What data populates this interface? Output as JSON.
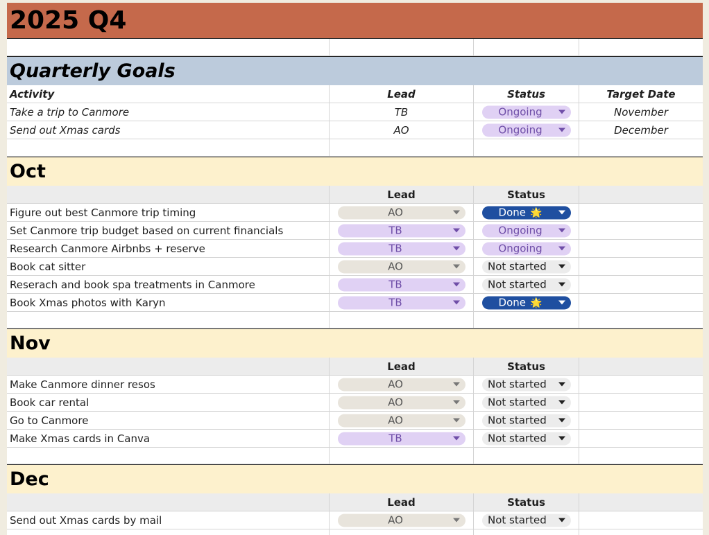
{
  "title": "2025 Q4",
  "goals": {
    "heading": "Quarterly Goals",
    "headers": [
      "Activity",
      "Lead",
      "Status",
      "Target Date"
    ],
    "rows": [
      {
        "activity": "Take a trip to Canmore",
        "lead": "TB",
        "status": "Ongoing",
        "target": "November"
      },
      {
        "activity": "Send out Xmas cards",
        "lead": "AO",
        "status": "Ongoing",
        "target": "December"
      }
    ]
  },
  "months": [
    {
      "name": "Oct",
      "lead_header": "Lead",
      "status_header": "Status",
      "tasks": [
        {
          "task": "Figure out best Canmore trip timing",
          "lead": "AO",
          "status": "Done",
          "star": "🌟"
        },
        {
          "task": "Set Canmore trip budget based on current financials",
          "lead": "TB",
          "status": "Ongoing"
        },
        {
          "task": "Research Canmore Airbnbs + reserve",
          "lead": "TB",
          "status": "Ongoing"
        },
        {
          "task": "Book cat sitter",
          "lead": "AO",
          "status": "Not started"
        },
        {
          "task": "Reserach and book spa treatments in Canmore",
          "lead": "TB",
          "status": "Not started"
        },
        {
          "task": "Book Xmas photos with Karyn",
          "lead": "TB",
          "status": "Done",
          "star": "🌟"
        }
      ]
    },
    {
      "name": "Nov",
      "lead_header": "Lead",
      "status_header": "Status",
      "tasks": [
        {
          "task": "Make Canmore dinner resos",
          "lead": "AO",
          "status": "Not started"
        },
        {
          "task": "Book car rental",
          "lead": "AO",
          "status": "Not started"
        },
        {
          "task": "Go to Canmore",
          "lead": "AO",
          "status": "Not started"
        },
        {
          "task": "Make Xmas cards in Canva",
          "lead": "TB",
          "status": "Not started"
        }
      ]
    },
    {
      "name": "Dec",
      "lead_header": "Lead",
      "status_header": "Status",
      "tasks": [
        {
          "task": "Send out Xmas cards by mail",
          "lead": "AO",
          "status": "Not started"
        }
      ]
    }
  ],
  "colors": {
    "title_bg": "#c5694b",
    "goals_bg": "#bccbdc",
    "month_bg": "#fdf1cd",
    "done": "#1f4fa0",
    "ongoing": "#e0d1f4",
    "lead_tb": "#e0d1f4",
    "lead_ao": "#e8e4dc"
  }
}
